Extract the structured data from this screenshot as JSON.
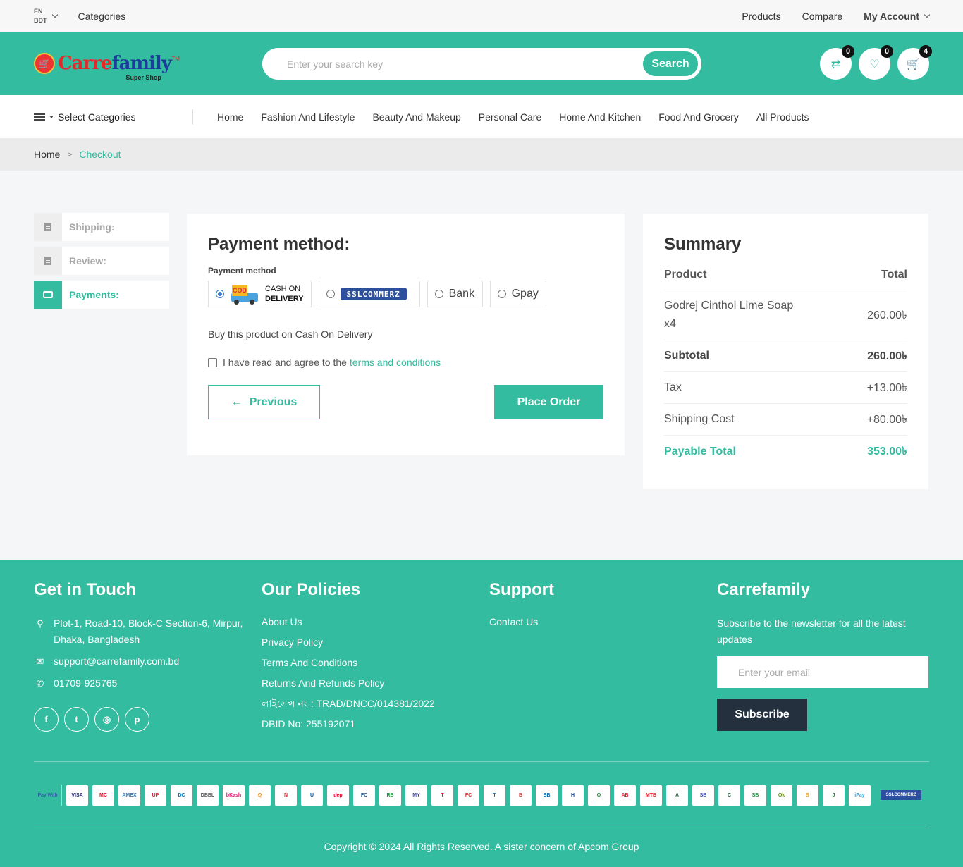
{
  "topbar": {
    "lang": "EN",
    "currency": "BDT",
    "categories": "Categories",
    "links": [
      "Products",
      "Compare"
    ],
    "account": "My Account"
  },
  "header": {
    "logo_part1": "Carre",
    "logo_part2": "family",
    "logo_tm": "TM",
    "logo_sub": "Super Shop",
    "search_placeholder": "Enter your search key",
    "search_button": "Search",
    "badges": {
      "compare": "0",
      "wishlist": "0",
      "cart": "4"
    }
  },
  "nav": {
    "select_categories": "Select Categories",
    "links": [
      "Home",
      "Fashion And Lifestyle",
      "Beauty And Makeup",
      "Personal Care",
      "Home And Kitchen",
      "Food And Grocery",
      "All Products"
    ]
  },
  "breadcrumb": {
    "home": "Home",
    "sep": ">",
    "current": "Checkout"
  },
  "steps": [
    {
      "label": "Shipping:",
      "icon": "document-icon"
    },
    {
      "label": "Review:",
      "icon": "document-icon"
    },
    {
      "label": "Payments:",
      "icon": "card-icon"
    }
  ],
  "payment": {
    "title": "Payment method:",
    "subtitle": "Payment method",
    "cod_line1": "CASH ON",
    "cod_line2": "DELIVERY",
    "cod_badge": "COD",
    "ssl_label": "SSLCOMMERZ",
    "bank": "Bank",
    "gpay": "Gpay",
    "description": "Buy this product on Cash On Delivery",
    "agree_prefix": "I have read and agree to the",
    "agree_link": "terms and conditions",
    "previous": "Previous",
    "place_order": "Place Order"
  },
  "summary": {
    "title": "Summary",
    "col_product": "Product",
    "col_total": "Total",
    "product_name": "Godrej Cinthol Lime Soap",
    "product_qty": "x4",
    "product_total": "260.00৳",
    "subtotal_label": "Subtotal",
    "subtotal": "260.00৳",
    "tax_label": "Tax",
    "tax": "+13.00৳",
    "shipping_label": "Shipping Cost",
    "shipping": "+80.00৳",
    "payable_label": "Payable Total",
    "payable": "353.00৳"
  },
  "footer": {
    "touch_title": "Get in Touch",
    "address": "Plot-1, Road-10, Block-C Section-6, Mirpur, Dhaka, Bangladesh",
    "email": "support@carrefamily.com.bd",
    "phone": "01709-925765",
    "policies_title": "Our Policies",
    "policies": [
      "About Us",
      "Privacy Policy",
      "Terms And Conditions",
      "Returns And Refunds Policy",
      "লাইসেন্স নং : TRAD/DNCC/014381/2022",
      "DBID No: 255192071"
    ],
    "support_title": "Support",
    "support_links": [
      "Contact Us"
    ],
    "brand_title": "Carrefamily",
    "newsletter": "Subscribe to the newsletter for all the latest updates",
    "email_placeholder": "Enter your email",
    "subscribe": "Subscribe",
    "pay_with": "Pay With",
    "pay_logos": [
      "VISA",
      "MC",
      "AMEX",
      "UP",
      "DC",
      "DBBL",
      "bKash",
      "Q",
      "N",
      "U",
      "dep",
      "FC",
      "RB",
      "MY",
      "T",
      "FC",
      "T",
      "B",
      "BB",
      "H",
      "O",
      "AB",
      "MTB",
      "A",
      "SB",
      "C",
      "SB",
      "Ok",
      "S",
      "J",
      "iPay"
    ],
    "ssl_small": "SSLCOMMERZ",
    "copyright": "Copyright © 2024 All Rights Reserved. A sister concern of Apcom Group"
  }
}
